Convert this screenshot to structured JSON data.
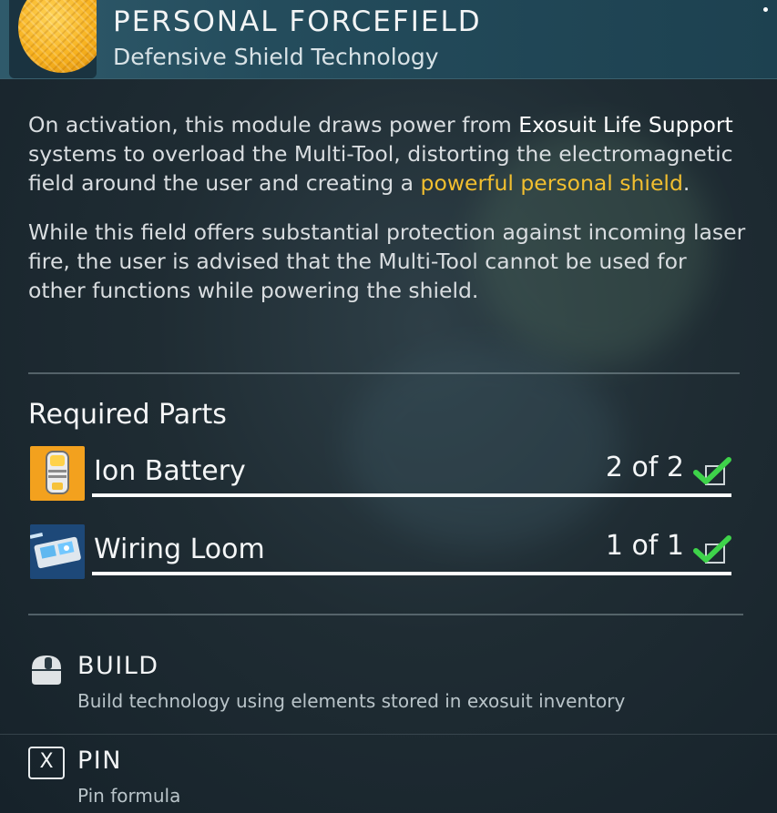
{
  "header": {
    "title": "PERSONAL FORCEFIELD",
    "subtitle": "Defensive Shield Technology",
    "icon": "golden-shield-orb-icon"
  },
  "description": {
    "p1_a": "On activation, this module draws power from ",
    "p1_b": "Exosuit Life Support",
    "p1_c": " systems to overload the Multi-Tool, distorting the electromagnetic field around the user and creating a ",
    "p1_d": "powerful personal shield",
    "p1_e": ".",
    "p2": "While this field offers substantial protection against incoming laser fire, the user is advised that the Multi-Tool cannot be used for other functions while powering the shield."
  },
  "required_parts": {
    "heading": "Required Parts",
    "items": [
      {
        "name": "Ion Battery",
        "count": "2 of 2",
        "icon": "ion-battery-icon",
        "complete": true
      },
      {
        "name": "Wiring Loom",
        "count": "1 of 1",
        "icon": "wiring-loom-icon",
        "complete": true
      }
    ]
  },
  "actions": [
    {
      "label": "BUILD",
      "description": "Build technology using elements stored in exosuit inventory",
      "icon": "mouse-icon"
    },
    {
      "label": "PIN",
      "description": "Pin formula",
      "icon": "x-key-icon"
    }
  ],
  "colors": {
    "highlight": "#f2bf2f",
    "check": "#3ed34a",
    "header_bg": "#2f5a6b"
  }
}
